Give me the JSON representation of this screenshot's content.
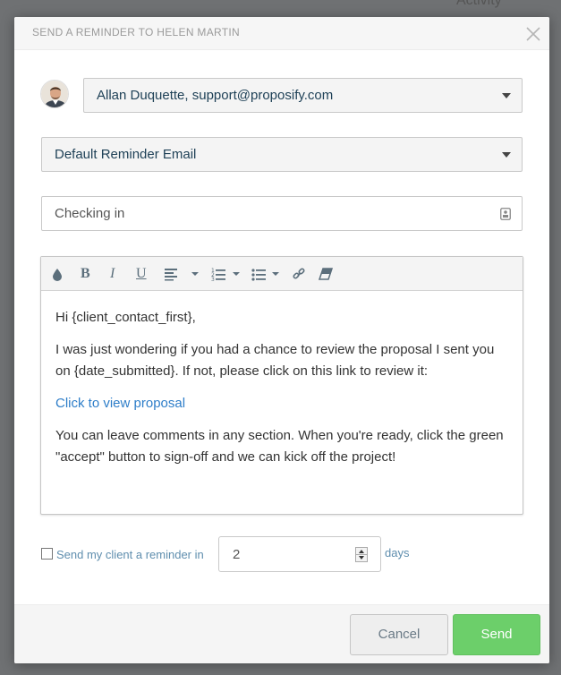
{
  "background": {
    "activity_label": "Activity"
  },
  "modal": {
    "title": "SEND A REMINDER TO HELEN MARTIN",
    "close_icon": "close-icon"
  },
  "sender": {
    "avatar_icon": "user-avatar",
    "selected": "Allan Duquette, support@proposify.com"
  },
  "template": {
    "selected": "Default Reminder Email"
  },
  "subject": {
    "value": "Checking in",
    "icon": "contact-card-icon"
  },
  "toolbar": {
    "items": [
      "color-drop-icon",
      "bold-icon",
      "italic-icon",
      "underline-icon",
      "align-icon",
      "ordered-list-icon",
      "unordered-list-icon",
      "link-icon",
      "eraser-icon"
    ],
    "bold_glyph": "B",
    "italic_glyph": "I",
    "underline_glyph": "U"
  },
  "message": {
    "greeting": "Hi {client_contact_first},",
    "paragraph1": "I was just wondering if you had a chance to review the proposal I sent you on {date_submitted}. If not, please click on this link to review it:",
    "link_text": "Click to view proposal",
    "paragraph2": "You can leave comments in any section. When you're ready, click the green \"accept\" button to sign-off and we can kick off the project!"
  },
  "reminder": {
    "checked": false,
    "label": "Send my client a reminder in",
    "value": "2",
    "unit": "days"
  },
  "footer": {
    "cancel_label": "Cancel",
    "send_label": "Send"
  },
  "colors": {
    "send_button": "#6ccf6a",
    "link": "#2e7ec9",
    "label": "#5f8eae"
  }
}
